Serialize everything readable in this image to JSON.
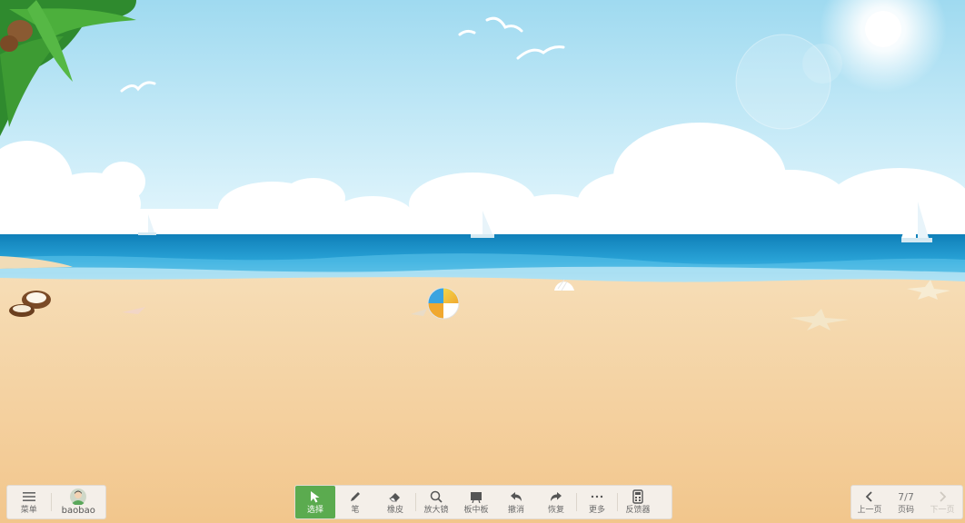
{
  "left_toolbar": {
    "menu_label": "菜单",
    "user_label": "baobao"
  },
  "center_toolbar": {
    "tools": [
      {
        "label": "选择",
        "icon": "cursor-arrow-icon",
        "active": true
      },
      {
        "label": "笔",
        "icon": "pen-icon"
      },
      {
        "label": "橡皮",
        "icon": "eraser-icon"
      },
      {
        "label": "放大镜",
        "icon": "magnifier-icon"
      },
      {
        "label": "板中板",
        "icon": "board-in-board-icon"
      },
      {
        "label": "撤消",
        "icon": "undo-icon"
      },
      {
        "label": "恢复",
        "icon": "redo-icon"
      },
      {
        "label": "更多",
        "icon": "more-dots-icon"
      },
      {
        "label": "反馈器",
        "icon": "clicker-device-icon"
      }
    ]
  },
  "right_toolbar": {
    "prev_label": "上一页",
    "page_indicator": "7/7",
    "page_label": "页码",
    "next_label": "下一页"
  },
  "colors": {
    "active_green": "#5bab4f",
    "toolbar_bg": "#f4efe9",
    "sky_top": "#9fdaf0",
    "sea": "#1d8fc4",
    "sand": "#f4cf9a"
  }
}
